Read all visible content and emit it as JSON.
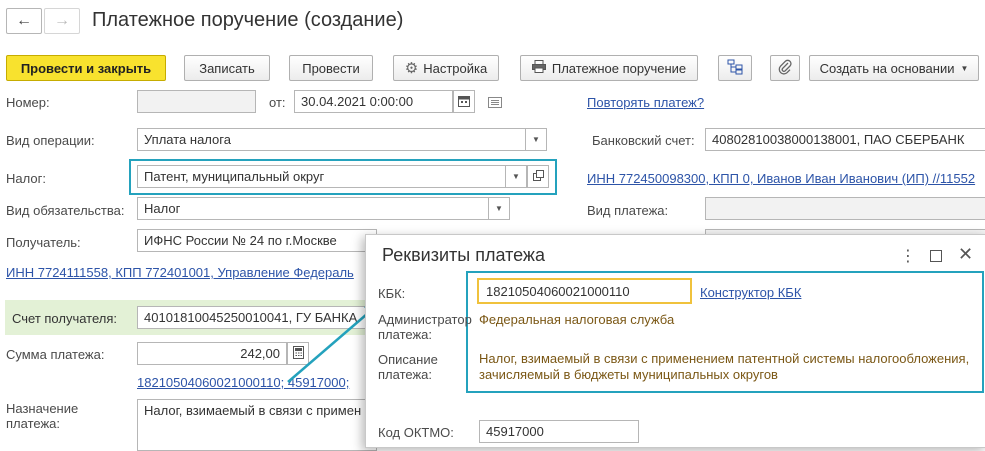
{
  "header": {
    "title": "Платежное поручение (создание)",
    "nav_back": "←",
    "nav_forward": "→"
  },
  "toolbar": {
    "post_close": "Провести и закрыть",
    "save": "Записать",
    "post": "Провести",
    "settings": "Настройка",
    "payment_order": "Платежное поручение",
    "create_based": "Создать на основании"
  },
  "form": {
    "number_label": "Номер:",
    "number_value": "",
    "from_label": "от:",
    "date_value": "30.04.2021 0:00:00",
    "repeat_link": "Повторять платеж?",
    "operation_label": "Вид операции:",
    "operation_value": "Уплата налога",
    "bank_account_label": "Банковский счет:",
    "bank_account_value": "40802810038000138001, ПАО СБЕРБАНК",
    "tax_label": "Налог:",
    "tax_value": "Патент, муниципальный округ",
    "payer_link": "ИНН 772450098300, КПП 0, Иванов Иван Иванович (ИП) //11552",
    "obligation_label": "Вид обязательства:",
    "obligation_value": "Налог",
    "payment_kind_label": "Вид платежа:",
    "payment_kind_value": "",
    "recipient_label": "Получатель:",
    "recipient_value": "ИФНС России № 24 по г.Москве",
    "recipient_link": "ИНН 7724111558, КПП 772401001, Управление Федераль",
    "recipient_account_label": "Счет получателя:",
    "recipient_account_value": "40101810045250010041, ГУ БАНКА",
    "amount_label": "Сумма платежа:",
    "amount_value": "242,00",
    "requisites_link": "18210504060021000110; 45917000; ",
    "purpose_label_1": "Назначение",
    "purpose_label_2": "платежа:",
    "purpose_value": "Налог, взимаемый в связи с примен"
  },
  "dialog": {
    "title": "Реквизиты платежа",
    "kbk_label": "КБК:",
    "kbk_value": "18210504060021000110",
    "kbk_constructor_link": "Конструктор КБК",
    "admin_label_1": "Администратор",
    "admin_label_2": "платежа:",
    "admin_value": "Федеральная налоговая служба",
    "desc_label_1": "Описание",
    "desc_label_2": "платежа:",
    "desc_value_1": "Налог, взимаемый в связи с применением патентной системы налогообложения,",
    "desc_value_2": "зачисляемый в бюджеты муниципальных округов",
    "oktmo_label": "Код ОКТМО:",
    "oktmo_value": "45917000"
  },
  "colors": {
    "highlight": "#24a2bd",
    "primary_button": "#f8e22e",
    "link": "#2d54a8",
    "kbk_border": "#f0c23c",
    "description_text": "#7b5816"
  },
  "icons": [
    "arrow-left-icon",
    "arrow-right-icon",
    "gear-icon",
    "printer-icon",
    "structure-icon",
    "paperclip-icon",
    "calendar-icon",
    "list-icon",
    "open-form-icon",
    "calculator-icon",
    "more-vertical-icon",
    "maximize-icon",
    "close-icon",
    "chevron-down-icon"
  ]
}
